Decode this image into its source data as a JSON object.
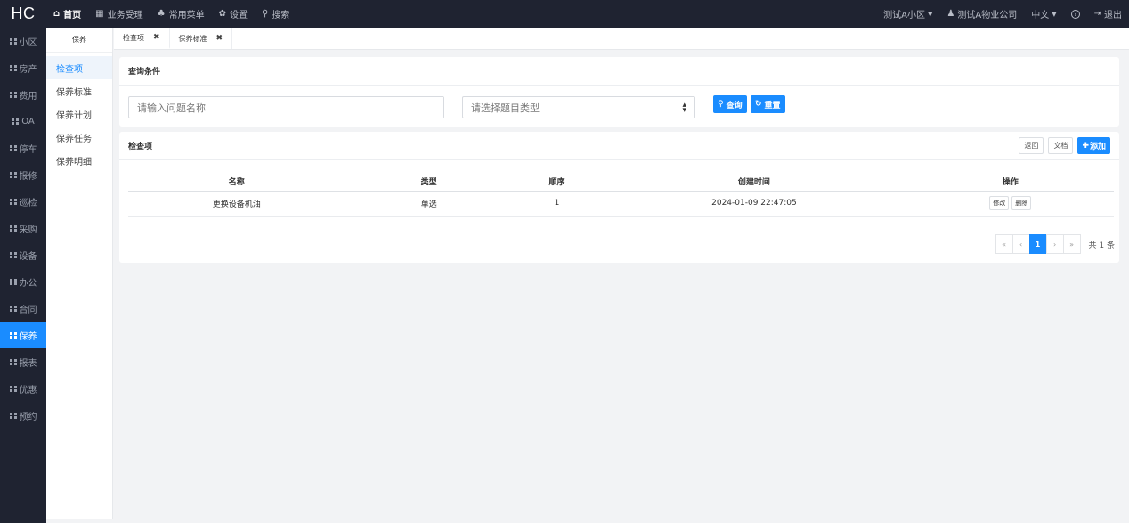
{
  "app": {
    "logo": "HC"
  },
  "topnav": [
    {
      "icon": "⌂",
      "label": "首页"
    },
    {
      "icon": "▦",
      "label": "业务受理"
    },
    {
      "icon": "♣",
      "label": "常用菜单"
    },
    {
      "icon": "✿",
      "label": "设置"
    },
    {
      "icon": "⚲",
      "label": "搜索"
    }
  ],
  "topright": {
    "community": "测试A小区",
    "company": "测试A物业公司",
    "language": "中文",
    "help_icon": "?",
    "logout": "退出"
  },
  "sidebar": [
    "小区",
    "房产",
    "费用",
    "OA",
    "停车",
    "报修",
    "巡检",
    "采购",
    "设备",
    "办公",
    "合同",
    "保养",
    "报表",
    "优惠",
    "预约"
  ],
  "sidebar_active": "保养",
  "submenu": {
    "title": "保养",
    "items": [
      "检查项",
      "保养标准",
      "保养计划",
      "保养任务",
      "保养明细"
    ]
  },
  "tabs": [
    {
      "label": "检查项",
      "close": "✖"
    },
    {
      "label": "保养标准",
      "close": "✖"
    }
  ],
  "query": {
    "title": "查询条件",
    "name_placeholder": "请输入问题名称",
    "type_placeholder": "请选择题目类型",
    "search_label": "查询",
    "reset_label": "重置"
  },
  "list": {
    "title": "检查项",
    "back_label": "返回",
    "doc_label": "文档",
    "add_label": "添加",
    "columns": [
      "名称",
      "类型",
      "顺序",
      "创建时间",
      "操作"
    ],
    "rows": [
      {
        "name": "更换设备机油",
        "type": "单选",
        "order": "1",
        "created": "2024-01-09 22:47:05",
        "edit": "修改",
        "delete": "删除"
      }
    ]
  },
  "pagination": {
    "first": "«",
    "prev": "‹",
    "current": "1",
    "next": "›",
    "last": "»",
    "total": "共 1 条"
  }
}
